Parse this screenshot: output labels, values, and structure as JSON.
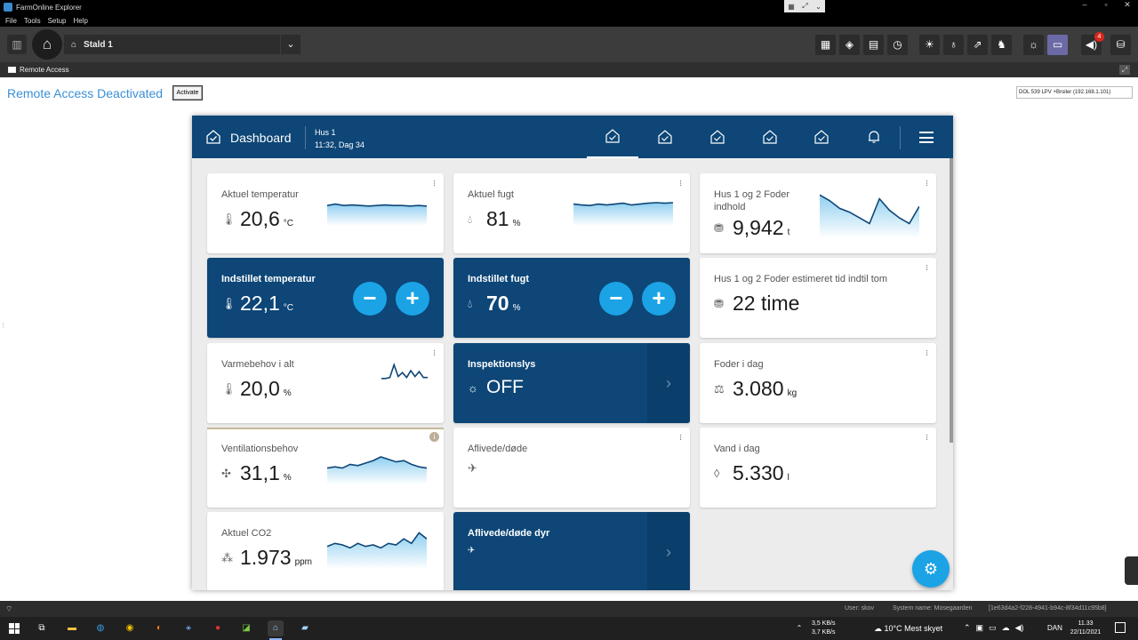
{
  "window": {
    "title": "FarmOnline Explorer",
    "controls": [
      "–",
      "▫",
      "✕"
    ]
  },
  "menu": [
    "File",
    "Tools",
    "Setup",
    "Help"
  ],
  "toolbar": {
    "stable": "Stald 1"
  },
  "remote_access": {
    "bar_label": "Remote Access",
    "status": "Remote Access Deactivated",
    "activate_label": "Activate",
    "device": "DOL 539 LPV +Broiler (192.168.1.101)"
  },
  "alarm_count": "4",
  "dashboard": {
    "title": "Dashboard",
    "house": "Hus 1",
    "time": "11:32, Dag 34"
  },
  "cards": {
    "temp": {
      "label": "Aktuel temperatur",
      "value": "20,6",
      "unit": "°C"
    },
    "humidity": {
      "label": "Aktuel fugt",
      "value": "81",
      "unit": "%"
    },
    "feed_content": {
      "label": "Hus 1 og 2 Foder indhold",
      "value": "9,942",
      "unit": "t"
    },
    "set_temp": {
      "label": "Indstillet temperatur",
      "value": "22,1",
      "unit": "°C"
    },
    "set_humidity": {
      "label": "Indstillet fugt",
      "value": "70",
      "unit": "%"
    },
    "feed_time": {
      "label": "Hus 1 og 2 Foder estimeret tid indtil tom",
      "value": "22 time"
    },
    "heat": {
      "label": "Varmebehov i alt",
      "value": "20,0",
      "unit": "%"
    },
    "inspection": {
      "label": "Inspektionslys",
      "value": "OFF"
    },
    "feed_day": {
      "label": "Foder i dag",
      "value": "3.080",
      "unit": "kg"
    },
    "ventilation": {
      "label": "Ventilationsbehov",
      "value": "31,1",
      "unit": "%"
    },
    "dead": {
      "label": "Aflivede/døde"
    },
    "water": {
      "label": "Vand i dag",
      "value": "5.330",
      "unit": "l"
    },
    "co2": {
      "label": "Aktuel CO2",
      "value": "1.973",
      "unit": "ppm"
    },
    "dead_animals": {
      "label": "Aflivede/døde dyr"
    }
  },
  "sparklines": {
    "temp": [
      0.6,
      0.55,
      0.6,
      0.58,
      0.6,
      0.62,
      0.6,
      0.58,
      0.6,
      0.6,
      0.62,
      0.6,
      0.62
    ],
    "humidity": [
      0.55,
      0.58,
      0.6,
      0.55,
      0.58,
      0.55,
      0.52,
      0.58,
      0.55,
      0.52,
      0.5,
      0.52,
      0.5
    ],
    "feed_content": [
      0.1,
      0.25,
      0.45,
      0.55,
      0.7,
      0.85,
      0.2,
      0.5,
      0.7,
      0.85,
      0.4
    ],
    "heat": [
      0.9,
      0.9,
      0.85,
      0.2,
      0.8,
      0.6,
      0.85,
      0.5,
      0.8,
      0.55,
      0.85,
      0.85
    ],
    "ventilation": [
      0.7,
      0.65,
      0.7,
      0.55,
      0.6,
      0.5,
      0.4,
      0.25,
      0.35,
      0.45,
      0.4,
      0.55,
      0.65,
      0.7
    ],
    "co2": [
      0.55,
      0.45,
      0.5,
      0.6,
      0.45,
      0.55,
      0.5,
      0.6,
      0.45,
      0.5,
      0.3,
      0.45,
      0.1,
      0.3
    ]
  },
  "status": {
    "user": "User: skov",
    "system": "System name: Mosegaarden",
    "guid": "[1e63d4a2-f228-4941-b94c-8f34d11c95b8]"
  },
  "taskbar": {
    "net_up": "3,5 KB/s",
    "net_down": "3,7 KB/s",
    "weather": "10°C  Mest skyet",
    "lang": "DAN",
    "time": "11.33",
    "date": "22/11/2021"
  }
}
